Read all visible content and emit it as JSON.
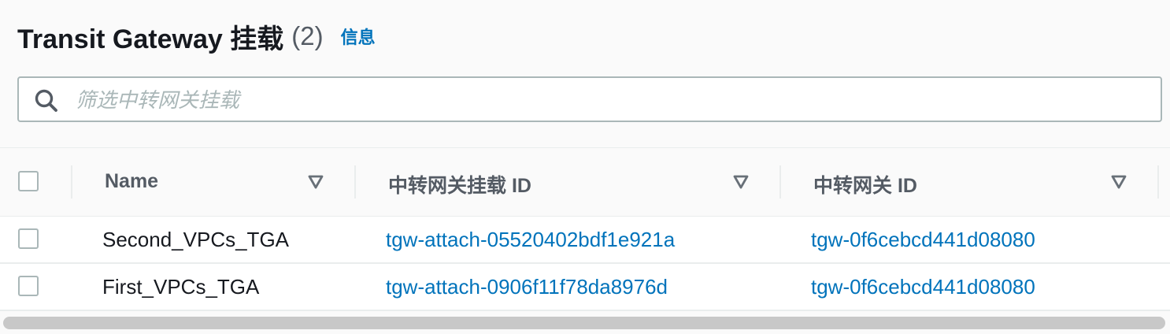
{
  "header": {
    "title": "Transit Gateway 挂载",
    "count": "(2)",
    "info_link": "信息"
  },
  "filter": {
    "placeholder": "筛选中转网关挂载",
    "value": "",
    "icon": "search-icon"
  },
  "table": {
    "columns": [
      {
        "label": "Name",
        "sort_icon": "sort-down-icon"
      },
      {
        "label": "中转网关挂载 ID",
        "sort_icon": "sort-down-icon"
      },
      {
        "label": "中转网关 ID",
        "sort_icon": "sort-down-icon"
      }
    ],
    "rows": [
      {
        "name": "Second_VPCs_TGA",
        "attachment_id": "tgw-attach-05520402bdf1e921a",
        "gateway_id": "tgw-0f6cebcd441d08080",
        "selected": false
      },
      {
        "name": "First_VPCs_TGA",
        "attachment_id": "tgw-attach-0906f11f78da8976d",
        "gateway_id": "tgw-0f6cebcd441d08080",
        "selected": false
      }
    ]
  },
  "colors": {
    "link": "#0073bb",
    "text": "#16191f",
    "header_text": "#545b64",
    "border": "#aab7b8",
    "divider": "#eaeded"
  }
}
